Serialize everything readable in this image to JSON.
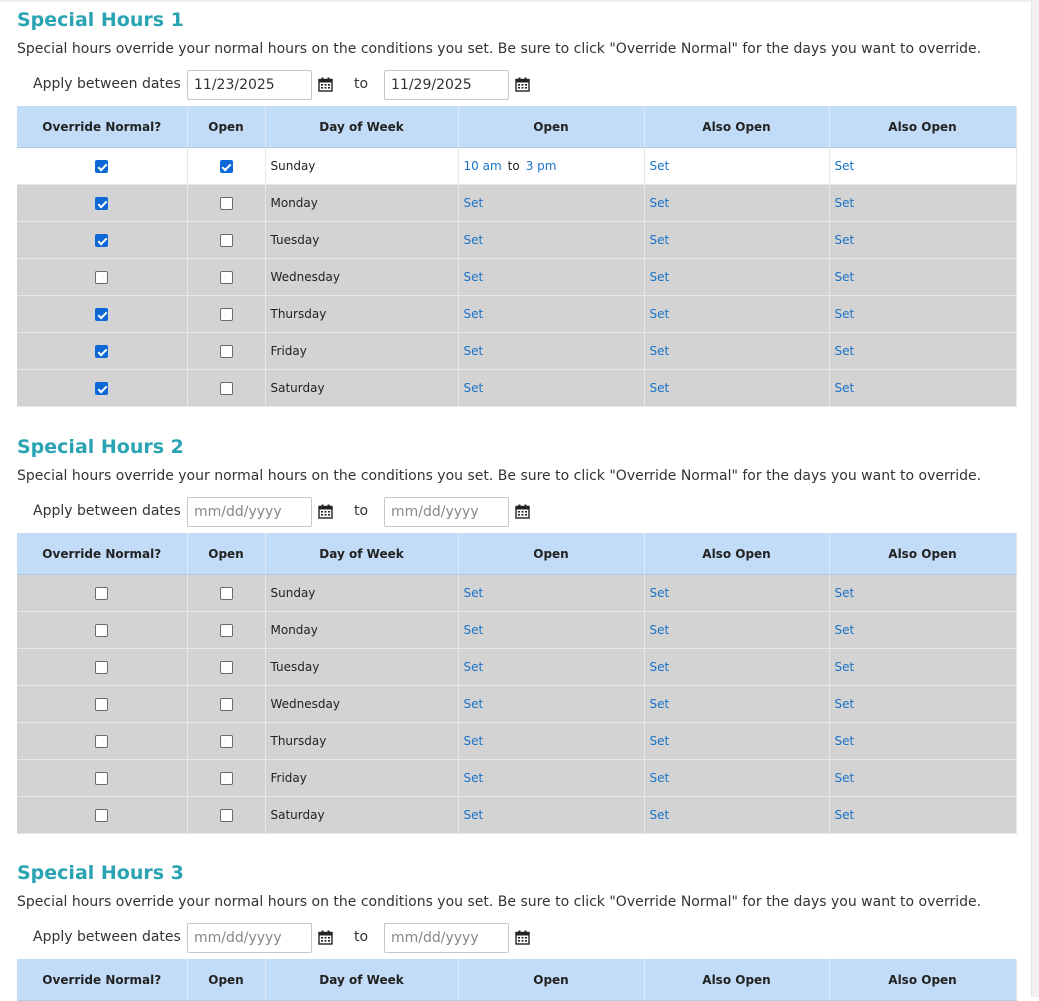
{
  "labels": {
    "description": "Special hours override your normal hours on the conditions you set. Be sure to click \"Override Normal\" for the days you want to override.",
    "apply_between": "Apply between dates :",
    "to": "to",
    "set": "Set"
  },
  "columns": [
    "Override Normal?",
    "Open",
    "Day of Week",
    "Open",
    "Also Open",
    "Also Open"
  ],
  "sections": [
    {
      "title": "Special Hours 1",
      "start_date": "11/23/2025",
      "end_date": "11/29/2025",
      "rows": [
        {
          "day": "Sunday",
          "override": true,
          "open": true,
          "slot1_from": "10 am",
          "slot1_to": "3 pm"
        },
        {
          "day": "Monday",
          "override": true,
          "open": false
        },
        {
          "day": "Tuesday",
          "override": true,
          "open": false
        },
        {
          "day": "Wednesday",
          "override": false,
          "open": false
        },
        {
          "day": "Thursday",
          "override": true,
          "open": false
        },
        {
          "day": "Friday",
          "override": true,
          "open": false
        },
        {
          "day": "Saturday",
          "override": true,
          "open": false
        }
      ]
    },
    {
      "title": "Special Hours 2",
      "start_date": "",
      "end_date": "",
      "date_placeholder": "mm/dd/yyyy",
      "rows": [
        {
          "day": "Sunday",
          "override": false,
          "open": false
        },
        {
          "day": "Monday",
          "override": false,
          "open": false
        },
        {
          "day": "Tuesday",
          "override": false,
          "open": false
        },
        {
          "day": "Wednesday",
          "override": false,
          "open": false
        },
        {
          "day": "Thursday",
          "override": false,
          "open": false
        },
        {
          "day": "Friday",
          "override": false,
          "open": false
        },
        {
          "day": "Saturday",
          "override": false,
          "open": false
        }
      ]
    },
    {
      "title": "Special Hours 3",
      "start_date": "",
      "end_date": "",
      "date_placeholder": "mm/dd/yyyy",
      "rows": []
    }
  ],
  "colors": {
    "title": "#2aa3b3",
    "header_bg": "#c2dcf7",
    "row_bg": "#d3d3d3",
    "active_row_bg": "#ffffff",
    "link": "#1a73c8",
    "checkbox": "#0b68d6"
  },
  "icons": {
    "calendar": "calendar-icon"
  }
}
